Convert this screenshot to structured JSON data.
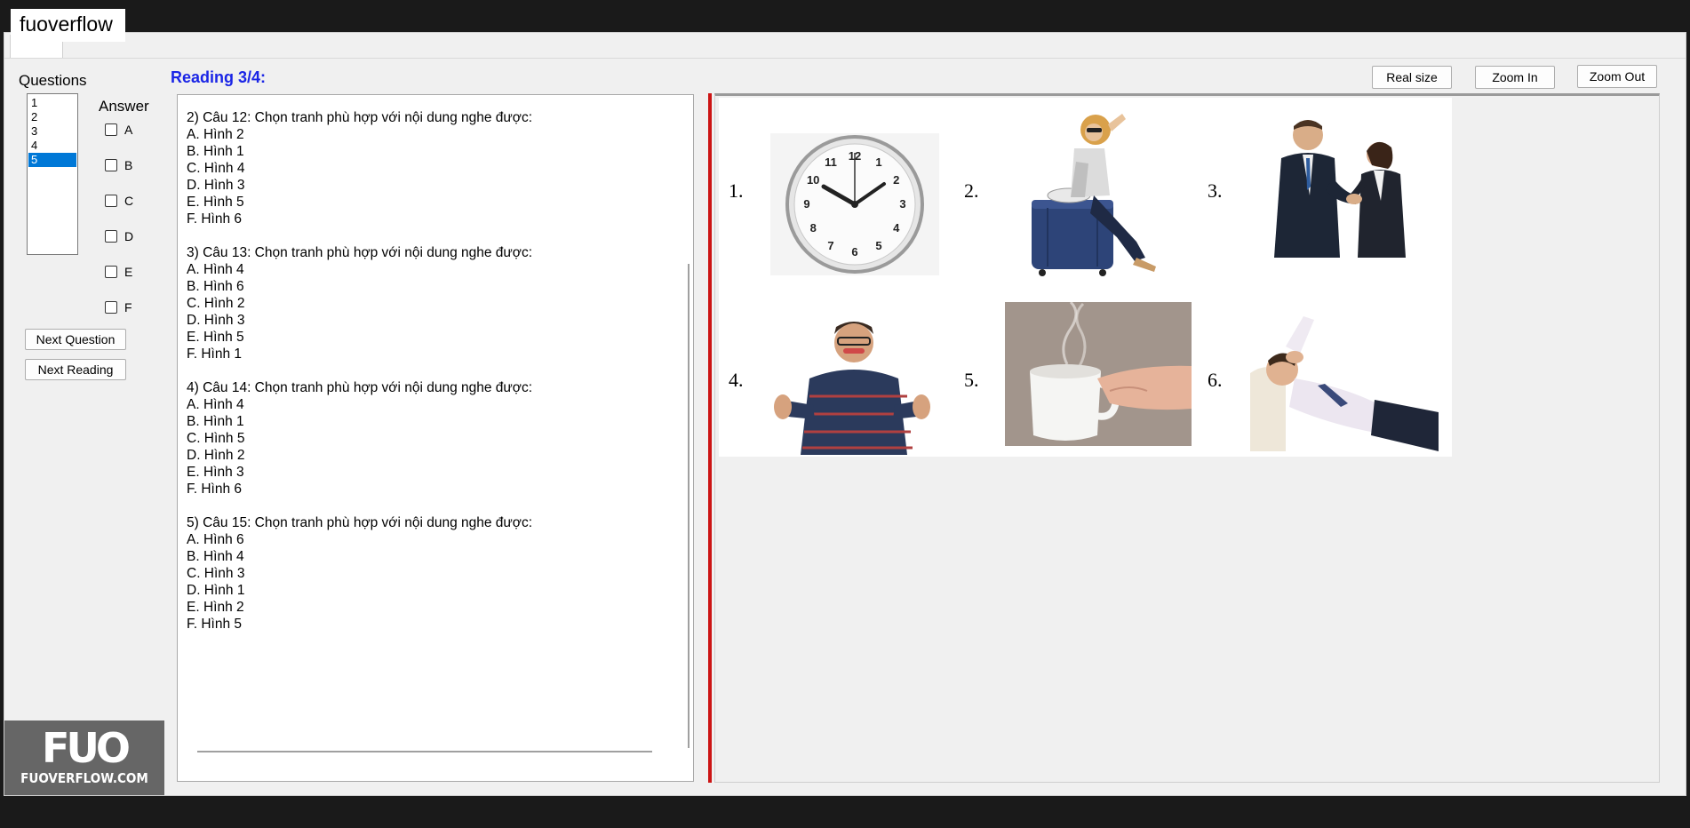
{
  "watermark": "fuoverflow",
  "sidebar": {
    "questions_label": "Questions",
    "questions": [
      "1",
      "2",
      "3",
      "4",
      "5"
    ],
    "selected_question": "5",
    "answer_label": "Answer",
    "options": [
      "A",
      "B",
      "C",
      "D",
      "E",
      "F"
    ],
    "next_question": "Next Question",
    "next_reading": "Next Reading"
  },
  "header": {
    "reading_title": "Reading 3/4:",
    "real_size": "Real size",
    "zoom_in": "Zoom In",
    "zoom_out": "Zoom Out"
  },
  "reading_questions": [
    {
      "prompt": "2) Câu 12: Chọn tranh phù hợp với nội dung nghe được:",
      "answers": [
        "A.  Hình 2",
        "B.  Hình 1",
        "C.  Hình 4",
        "D.  Hình 3",
        "E.  Hình 5",
        "F.  Hình 6"
      ]
    },
    {
      "prompt": "3) Câu 13: Chọn tranh phù hợp với nội dung nghe được:",
      "answers": [
        "A.  Hình 4",
        "B.  Hình 6",
        "C.  Hình 2",
        "D.  Hình 3",
        "E.  Hình 5",
        "F.  Hình 1"
      ]
    },
    {
      "prompt": "4) Câu 14: Chọn tranh phù hợp với nội dung nghe được:",
      "answers": [
        "A.  Hình 4",
        "B.  Hình 1",
        "C.  Hình 5",
        "D.  Hình 2",
        "E.  Hình 3",
        "F.  Hình 6"
      ]
    },
    {
      "prompt": "5) Câu 15: Chọn tranh phù hợp với nội dung nghe được:",
      "answers": [
        "A.  Hình 6",
        "B.  Hình 4",
        "C.  Hình 3",
        "D.  Hình 1",
        "E.  Hình 2",
        "F.  Hình 5"
      ]
    }
  ],
  "pictures": {
    "labels": [
      "1.",
      "2.",
      "3.",
      "4.",
      "5.",
      "6."
    ],
    "subjects": [
      "clock-picture",
      "woman-with-suitcase-picture",
      "handshake-picture",
      "man-refusing-picture",
      "coffee-cup-picture",
      "man-resting-on-sofa-picture"
    ],
    "clock_numbers": [
      "12",
      "1",
      "2",
      "3",
      "4",
      "5",
      "6",
      "7",
      "8",
      "9",
      "10",
      "11"
    ]
  },
  "logo": {
    "mark": "FUO",
    "text": "FUOVERFLOW.COM"
  }
}
